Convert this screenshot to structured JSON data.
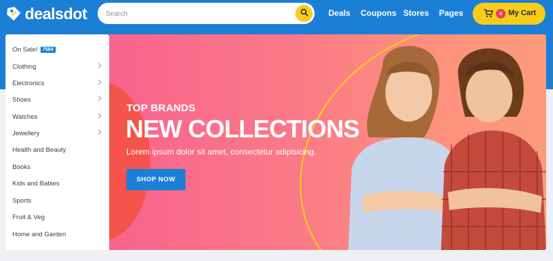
{
  "brand": {
    "name": "dealsdot"
  },
  "search": {
    "placeholder": "Search"
  },
  "nav": {
    "items": [
      "Deals",
      "Coupons",
      "Stores",
      "Pages"
    ]
  },
  "cart": {
    "count": "0",
    "label": "My Cart"
  },
  "sidebar": {
    "sale": {
      "label": "On Sale!",
      "badge": "7584"
    },
    "items": [
      {
        "label": "Clothing",
        "has_submenu": true
      },
      {
        "label": "Electronics",
        "has_submenu": true
      },
      {
        "label": "Shoes",
        "has_submenu": true
      },
      {
        "label": "Watches",
        "has_submenu": true
      },
      {
        "label": "Jewellery",
        "has_submenu": true
      },
      {
        "label": "Health and Beauty",
        "has_submenu": false
      },
      {
        "label": "Books",
        "has_submenu": false
      },
      {
        "label": "Kids and Babies",
        "has_submenu": false
      },
      {
        "label": "Sports",
        "has_submenu": false
      },
      {
        "label": "Fruit & Veg",
        "has_submenu": false
      },
      {
        "label": "Home and Garden",
        "has_submenu": false
      }
    ]
  },
  "banner": {
    "kicker": "TOP BRANDS",
    "headline": "NEW COLLECTIONS",
    "subline": "Lorem ipsum dolor sit amet, consectetur adipisicing.",
    "cta": "SHOP NOW"
  },
  "colors": {
    "primary": "#1b7fd6",
    "accent": "#f7cc1b",
    "badge": "#ee3d5c"
  }
}
